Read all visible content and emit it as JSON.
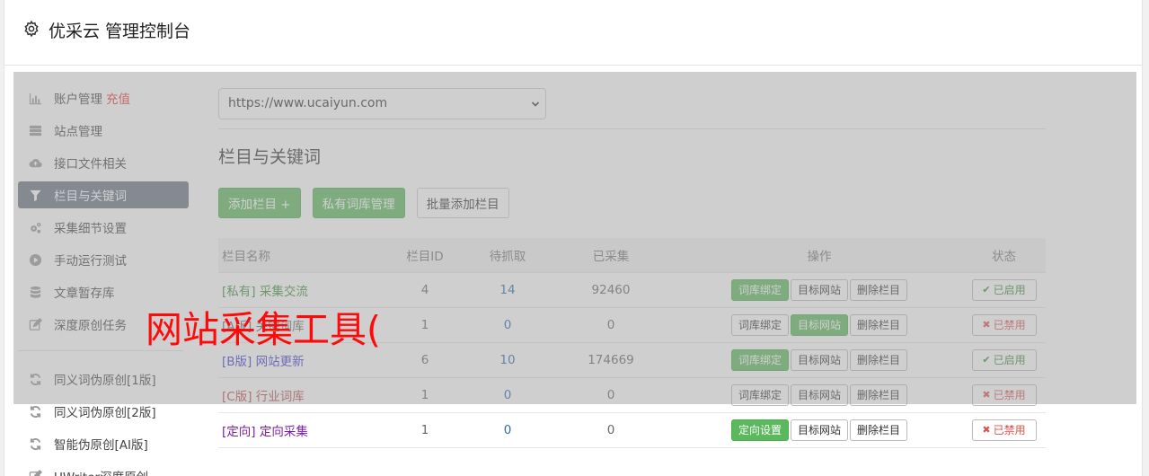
{
  "header": {
    "title": "优采云 管理控制台",
    "icon": "gear-icon"
  },
  "sidebar": {
    "items": [
      {
        "label": "账户管理",
        "extra": "充值",
        "icon": "bar-chart-icon"
      },
      {
        "label": "站点管理",
        "icon": "server-icon"
      },
      {
        "label": "接口文件相关",
        "icon": "cloud-upload-icon"
      },
      {
        "label": "栏目与关键词",
        "icon": "filter-icon",
        "active": true
      },
      {
        "label": "采集细节设置",
        "icon": "gears-icon"
      },
      {
        "label": "手动运行测试",
        "icon": "play-circle-icon"
      },
      {
        "label": "文章暂存库",
        "icon": "database-icon"
      },
      {
        "label": "深度原创任务",
        "icon": "edit-icon"
      },
      {
        "label": "同义词伪原创[1版]",
        "icon": "refresh-icon"
      },
      {
        "label": "同义词伪原创[2版]",
        "icon": "refresh-icon"
      },
      {
        "label": "智能伪原创[AI版]",
        "icon": "refresh-icon"
      },
      {
        "label": "UWriter深度原创",
        "icon": "edit-icon"
      }
    ]
  },
  "main": {
    "site_select": "https://www.ucaiyun.com",
    "section_title": "栏目与关键词",
    "buttons": {
      "add": "添加栏目 +",
      "private_lib": "私有词库管理",
      "batch_add": "批量添加栏目"
    },
    "table": {
      "headers": {
        "name": "栏目名称",
        "id": "栏目ID",
        "wait": "待抓取",
        "done": "已采集",
        "ops": "操作",
        "status": "状态"
      },
      "rows": [
        {
          "tag": "[私有]",
          "name": "采集交流",
          "color": "#3c8d3c",
          "id": "4",
          "wait": "14",
          "done": "92460",
          "op1": "词库绑定",
          "op1_green": true,
          "op2": "目标网站",
          "op2_green": false,
          "op3": "删除栏目",
          "status": "已启用",
          "enabled": true
        },
        {
          "tag": "[A版]",
          "name": "关键词库",
          "color": "#666666",
          "id": "1",
          "wait": "0",
          "done": "0",
          "op1": "词库绑定",
          "op1_green": false,
          "op2": "目标网站",
          "op2_green": true,
          "op3": "删除栏目",
          "status": "已禁用",
          "enabled": false
        },
        {
          "tag": "[B版]",
          "name": "网站更新",
          "color": "#3a3acc",
          "id": "6",
          "wait": "10",
          "done": "174669",
          "op1": "词库绑定",
          "op1_green": true,
          "op2": "目标网站",
          "op2_green": false,
          "op3": "删除栏目",
          "status": "已启用",
          "enabled": true
        },
        {
          "tag": "[C版]",
          "name": "行业词库",
          "color": "#b94a48",
          "id": "1",
          "wait": "0",
          "done": "0",
          "op1": "词库绑定",
          "op1_green": false,
          "op2": "目标网站",
          "op2_green": false,
          "op3": "删除栏目",
          "status": "已禁用",
          "enabled": false
        },
        {
          "tag": "[定向]",
          "name": "定向采集",
          "color": "#7b1fa2",
          "id": "1",
          "wait": "0",
          "done": "0",
          "op1": "定向设置",
          "op1_green": true,
          "op2": "目标网站",
          "op2_green": false,
          "op3": "删除栏目",
          "status": "已禁用",
          "enabled": false
        }
      ]
    }
  },
  "watermark": "网站采集工具(",
  "colors": {
    "green": "#5cb85c",
    "active_nav": "#6b7280",
    "recharge": "#e53935",
    "link": "#2a6db0",
    "watermark": "#ff0a0a"
  }
}
